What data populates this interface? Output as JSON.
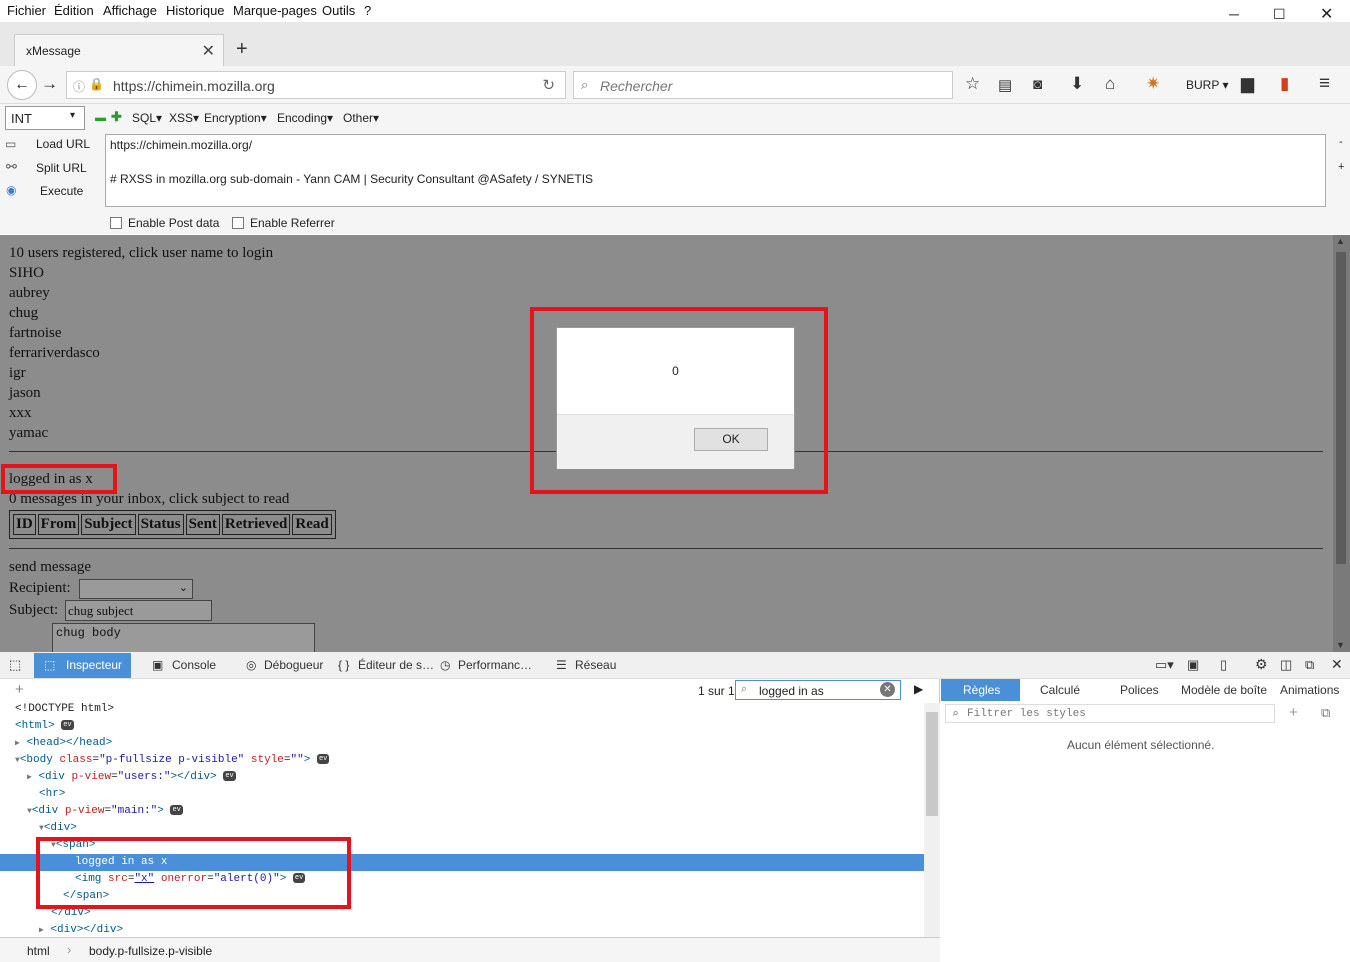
{
  "menubar": {
    "items": [
      "Fichier",
      "Édition",
      "Affichage",
      "Historique",
      "Marque-pages",
      "Outils",
      "?"
    ]
  },
  "tab": {
    "title": "xMessage"
  },
  "navbar": {
    "url": "https://chimein.mozilla.org",
    "search_placeholder": "Rechercher",
    "burp_label": "BURP"
  },
  "hackbar": {
    "level": "INT",
    "menus": [
      "SQL",
      "XSS",
      "Encryption",
      "Encoding",
      "Other"
    ],
    "load_url": "Load URL",
    "split_url": "Split URL",
    "execute": "Execute",
    "text_line1": "https://chimein.mozilla.org/",
    "text_line2": "# RXSS in mozilla.org sub-domain - Yann CAM | Security Consultant @ASafety / SYNETIS",
    "enable_post": "Enable Post data",
    "enable_referrer": "Enable Referrer"
  },
  "page": {
    "users_header": "10 users registered, click user name to login",
    "users": [
      "SIHO",
      "aubrey",
      "chug",
      "fartnoise",
      "ferrariverdasco",
      "igr",
      "jason",
      "xxx",
      "yamac"
    ],
    "logged_in": "logged in as x",
    "inbox": "0 messages in your inbox, click subject to read",
    "table_headers": [
      "ID",
      "From",
      "Subject",
      "Status",
      "Sent",
      "Retrieved",
      "Read"
    ],
    "send_message": "send message",
    "recipient_label": "Recipient:",
    "subject_label": "Subject:",
    "subject_value": "chug subject",
    "body_value": "chug body"
  },
  "dialog": {
    "message": "0",
    "ok": "OK"
  },
  "devtools": {
    "tabs": [
      "Inspecteur",
      "Console",
      "Débogueur",
      "Éditeur de s…",
      "Performanc…",
      "Réseau"
    ],
    "search_count": "1 sur 1",
    "search_value": "logged in as",
    "rules_tabs": [
      "Règles",
      "Calculé",
      "Polices",
      "Modèle de boîte",
      "Animations"
    ],
    "filter_placeholder": "Filtrer les styles",
    "no_selection": "Aucun élément sélectionné.",
    "breadcrumbs": [
      "html",
      "body.p-fullsize.p-visible"
    ],
    "markup": {
      "doctype": "<!DOCTYPE html>",
      "html_open": "<html>",
      "head": "<head></head>",
      "body_tag": "body",
      "body_class_attr": "class",
      "body_class_val": "\"p-fullsize p-visible\"",
      "body_style_attr": "style",
      "body_style_val": "\"\"",
      "div_users_attr": "p-view",
      "div_users_val": "\"users:\"",
      "hr": "<hr>",
      "div_main_val": "\"main:\"",
      "div_open": "<div>",
      "span_open": "<span>",
      "logged_text": "logged in as x",
      "img_src_val": "\"x\"",
      "img_onerror_attr": "onerror",
      "img_onerror_val": "\"alert(0)\"",
      "span_close": "</span>",
      "div_close": "</div>",
      "div_empty": "<div></div>",
      "ev": "ev"
    }
  },
  "colors": {
    "highlight_red": "#e3151a",
    "devtools_blue": "#4a90d9",
    "overlay_gray": "#8c8c8c"
  }
}
